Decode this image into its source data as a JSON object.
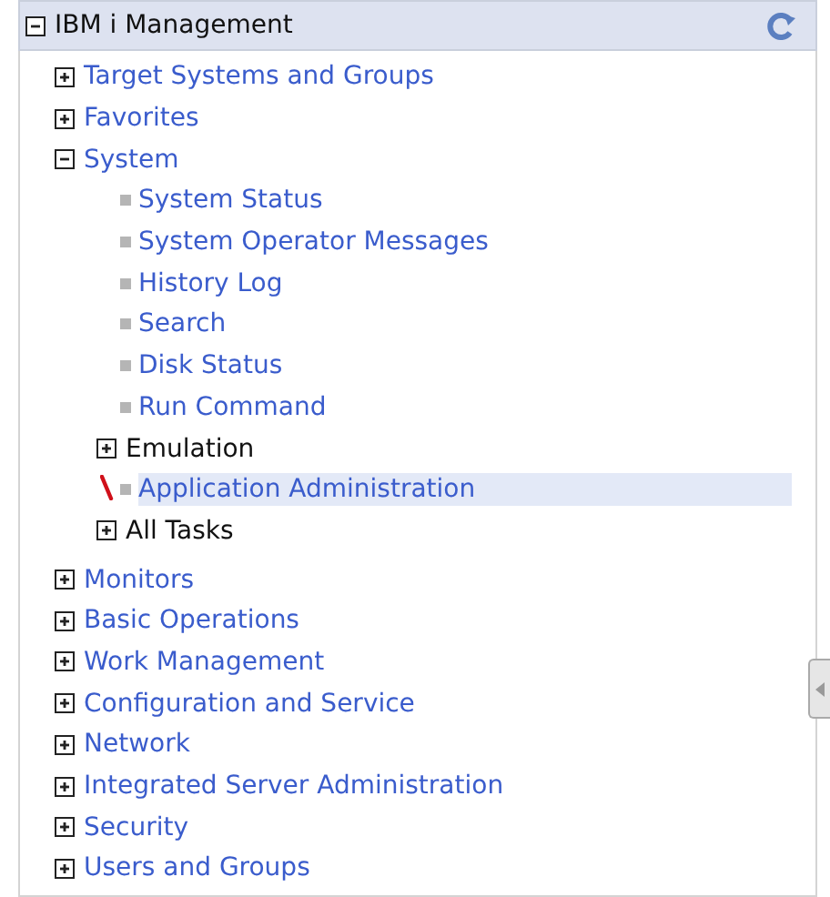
{
  "panel": {
    "title": "IBM i Management",
    "expanded": true
  },
  "sections": [
    {
      "items": [
        {
          "label": "Target Systems and Groups",
          "kind": "link",
          "expanded": false,
          "selected": false
        },
        {
          "label": "Favorites",
          "kind": "link",
          "expanded": false,
          "selected": false
        },
        {
          "label": "System",
          "kind": "link",
          "expanded": true,
          "selected": false,
          "children": [
            {
              "label": "System Status",
              "kind": "task",
              "selected": false
            },
            {
              "label": "System Operator Messages",
              "kind": "task",
              "selected": false
            },
            {
              "label": "History Log",
              "kind": "task",
              "selected": false
            },
            {
              "label": "Search",
              "kind": "task",
              "selected": false
            },
            {
              "label": "Disk Status",
              "kind": "task",
              "selected": false
            },
            {
              "label": "Run Command",
              "kind": "task",
              "selected": false
            },
            {
              "label": "Emulation",
              "kind": "folder",
              "expanded": false,
              "selected": false
            },
            {
              "label": "Application Administration",
              "kind": "task",
              "selected": true
            },
            {
              "label": "All Tasks",
              "kind": "folder",
              "expanded": false,
              "selected": false
            }
          ]
        }
      ]
    },
    {
      "items": [
        {
          "label": "Monitors",
          "kind": "link",
          "expanded": false,
          "selected": false
        },
        {
          "label": "Basic Operations",
          "kind": "link",
          "expanded": false,
          "selected": false
        },
        {
          "label": "Work Management",
          "kind": "link",
          "expanded": false,
          "selected": false
        },
        {
          "label": "Configuration and Service",
          "kind": "link",
          "expanded": false,
          "selected": false
        },
        {
          "label": "Network",
          "kind": "link",
          "expanded": false,
          "selected": false
        },
        {
          "label": "Integrated Server Administration",
          "kind": "link",
          "expanded": false,
          "selected": false
        },
        {
          "label": "Security",
          "kind": "link",
          "expanded": false,
          "selected": false
        },
        {
          "label": "Users and Groups",
          "kind": "link",
          "expanded": false,
          "selected": false
        }
      ]
    }
  ]
}
